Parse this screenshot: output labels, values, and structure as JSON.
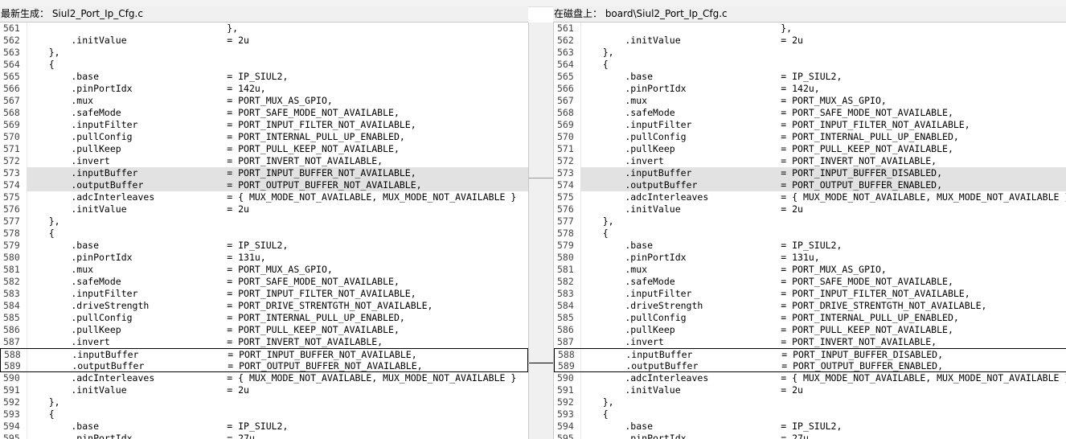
{
  "left_header": "最新生成： Siul2_Port_Ip_Cfg.c",
  "right_header": "在磁盘上： board\\Siul2_Port_Ip_Cfg.c",
  "left_lines": [
    {
      "n": "561",
      "t": "                                    },"
    },
    {
      "n": "562",
      "t": "        .initValue                  = 2u"
    },
    {
      "n": "563",
      "t": "    },"
    },
    {
      "n": "564",
      "t": "    {"
    },
    {
      "n": "565",
      "t": "        .base                       = IP_SIUL2,"
    },
    {
      "n": "566",
      "t": "        .pinPortIdx                 = 142u,"
    },
    {
      "n": "567",
      "t": "        .mux                        = PORT_MUX_AS_GPIO,"
    },
    {
      "n": "568",
      "t": "        .safeMode                   = PORT_SAFE_MODE_NOT_AVAILABLE,"
    },
    {
      "n": "569",
      "t": "        .inputFilter                = PORT_INPUT_FILTER_NOT_AVAILABLE,"
    },
    {
      "n": "570",
      "t": "        .pullConfig                 = PORT_INTERNAL_PULL_UP_ENABLED,"
    },
    {
      "n": "571",
      "t": "        .pullKeep                   = PORT_PULL_KEEP_NOT_AVAILABLE,"
    },
    {
      "n": "572",
      "t": "        .invert                     = PORT_INVERT_NOT_AVAILABLE,"
    },
    {
      "n": "573",
      "t": "        .inputBuffer                = PORT_INPUT_BUFFER_NOT_AVAILABLE,"
    },
    {
      "n": "574",
      "t": "        .outputBuffer               = PORT_OUTPUT_BUFFER_NOT_AVAILABLE,"
    },
    {
      "n": "575",
      "t": "        .adcInterleaves             = { MUX_MODE_NOT_AVAILABLE, MUX_MODE_NOT_AVAILABLE }"
    },
    {
      "n": "576",
      "t": "        .initValue                  = 2u"
    },
    {
      "n": "577",
      "t": "    },"
    },
    {
      "n": "578",
      "t": "    {"
    },
    {
      "n": "579",
      "t": "        .base                       = IP_SIUL2,"
    },
    {
      "n": "580",
      "t": "        .pinPortIdx                 = 131u,"
    },
    {
      "n": "581",
      "t": "        .mux                        = PORT_MUX_AS_GPIO,"
    },
    {
      "n": "582",
      "t": "        .safeMode                   = PORT_SAFE_MODE_NOT_AVAILABLE,"
    },
    {
      "n": "583",
      "t": "        .inputFilter                = PORT_INPUT_FILTER_NOT_AVAILABLE,"
    },
    {
      "n": "584",
      "t": "        .driveStrength              = PORT_DRIVE_STRENTGTH_NOT_AVAILABLE,"
    },
    {
      "n": "585",
      "t": "        .pullConfig                 = PORT_INTERNAL_PULL_UP_ENABLED,"
    },
    {
      "n": "586",
      "t": "        .pullKeep                   = PORT_PULL_KEEP_NOT_AVAILABLE,"
    },
    {
      "n": "587",
      "t": "        .invert                     = PORT_INVERT_NOT_AVAILABLE,"
    },
    {
      "n": "588",
      "t": "        .inputBuffer                = PORT_INPUT_BUFFER_NOT_AVAILABLE,"
    },
    {
      "n": "589",
      "t": "        .outputBuffer               = PORT_OUTPUT_BUFFER_NOT_AVAILABLE,"
    },
    {
      "n": "590",
      "t": "        .adcInterleaves             = { MUX_MODE_NOT_AVAILABLE, MUX_MODE_NOT_AVAILABLE }"
    },
    {
      "n": "591",
      "t": "        .initValue                  = 2u"
    },
    {
      "n": "592",
      "t": "    },"
    },
    {
      "n": "593",
      "t": "    {"
    },
    {
      "n": "594",
      "t": "        .base                       = IP_SIUL2,"
    },
    {
      "n": "595",
      "t": "        .pinPortIdx                 = 27u,"
    }
  ],
  "right_lines": [
    {
      "n": "561",
      "t": "                                    },"
    },
    {
      "n": "562",
      "t": "        .initValue                  = 2u"
    },
    {
      "n": "563",
      "t": "    },"
    },
    {
      "n": "564",
      "t": "    {"
    },
    {
      "n": "565",
      "t": "        .base                       = IP_SIUL2,"
    },
    {
      "n": "566",
      "t": "        .pinPortIdx                 = 142u,"
    },
    {
      "n": "567",
      "t": "        .mux                        = PORT_MUX_AS_GPIO,"
    },
    {
      "n": "568",
      "t": "        .safeMode                   = PORT_SAFE_MODE_NOT_AVAILABLE,"
    },
    {
      "n": "569",
      "t": "        .inputFilter                = PORT_INPUT_FILTER_NOT_AVAILABLE,"
    },
    {
      "n": "570",
      "t": "        .pullConfig                 = PORT_INTERNAL_PULL_UP_ENABLED,"
    },
    {
      "n": "571",
      "t": "        .pullKeep                   = PORT_PULL_KEEP_NOT_AVAILABLE,"
    },
    {
      "n": "572",
      "t": "        .invert                     = PORT_INVERT_NOT_AVAILABLE,"
    },
    {
      "n": "573",
      "t": "        .inputBuffer                = PORT_INPUT_BUFFER_DISABLED,"
    },
    {
      "n": "574",
      "t": "        .outputBuffer               = PORT_OUTPUT_BUFFER_ENABLED,"
    },
    {
      "n": "575",
      "t": "        .adcInterleaves             = { MUX_MODE_NOT_AVAILABLE, MUX_MODE_NOT_AVAILABLE }"
    },
    {
      "n": "576",
      "t": "        .initValue                  = 2u"
    },
    {
      "n": "577",
      "t": "    },"
    },
    {
      "n": "578",
      "t": "    {"
    },
    {
      "n": "579",
      "t": "        .base                       = IP_SIUL2,"
    },
    {
      "n": "580",
      "t": "        .pinPortIdx                 = 131u,"
    },
    {
      "n": "581",
      "t": "        .mux                        = PORT_MUX_AS_GPIO,"
    },
    {
      "n": "582",
      "t": "        .safeMode                   = PORT_SAFE_MODE_NOT_AVAILABLE,"
    },
    {
      "n": "583",
      "t": "        .inputFilter                = PORT_INPUT_FILTER_NOT_AVAILABLE,"
    },
    {
      "n": "584",
      "t": "        .driveStrength              = PORT_DRIVE_STRENTGTH_NOT_AVAILABLE,"
    },
    {
      "n": "585",
      "t": "        .pullConfig                 = PORT_INTERNAL_PULL_UP_ENABLED,"
    },
    {
      "n": "586",
      "t": "        .pullKeep                   = PORT_PULL_KEEP_NOT_AVAILABLE,"
    },
    {
      "n": "587",
      "t": "        .invert                     = PORT_INVERT_NOT_AVAILABLE,"
    },
    {
      "n": "588",
      "t": "        .inputBuffer                = PORT_INPUT_BUFFER_DISABLED,"
    },
    {
      "n": "589",
      "t": "        .outputBuffer               = PORT_OUTPUT_BUFFER_ENABLED,"
    },
    {
      "n": "590",
      "t": "        .adcInterleaves             = { MUX_MODE_NOT_AVAILABLE, MUX_MODE_NOT_AVAILABLE }"
    },
    {
      "n": "591",
      "t": "        .initValue                  = 2u"
    },
    {
      "n": "592",
      "t": "    },"
    },
    {
      "n": "593",
      "t": "    {"
    },
    {
      "n": "594",
      "t": "        .base                       = IP_SIUL2,"
    },
    {
      "n": "595",
      "t": "        .pinPortIdx                 = 27u,"
    }
  ]
}
